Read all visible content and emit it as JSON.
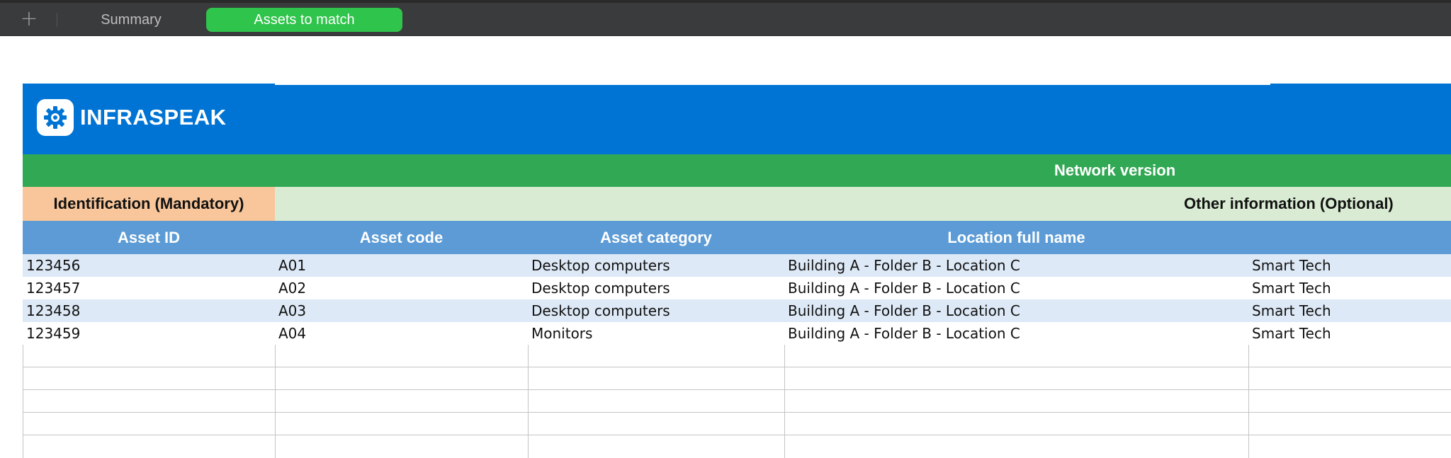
{
  "tabs": {
    "add_label": "+",
    "items": [
      {
        "label": "Summary",
        "active": false
      },
      {
        "label": "Assets to match",
        "active": true
      }
    ]
  },
  "brand": {
    "logo_text": "INFRASPEAK",
    "blue": "#0074d4",
    "green": "#31a853"
  },
  "sheet": {
    "version_title": "Network version",
    "section_mandatory": "Identification (Mandatory)",
    "section_optional": "Other information (Optional)",
    "headers": [
      "Asset ID",
      "Asset code",
      "Asset category",
      "Location full name",
      ""
    ],
    "rows": [
      [
        "123456",
        "A01",
        "Desktop computers",
        "Building A - Folder B - Location C",
        "Smart Tech"
      ],
      [
        "123457",
        "A02",
        "Desktop computers",
        "Building A - Folder B - Location C",
        "Smart Tech"
      ],
      [
        "123458",
        "A03",
        "Desktop computers",
        "Building A - Folder B - Location C",
        "Smart Tech"
      ],
      [
        "123459",
        "A04",
        "Monitors",
        "Building A - Folder B - Location C",
        "Smart Tech"
      ]
    ]
  }
}
